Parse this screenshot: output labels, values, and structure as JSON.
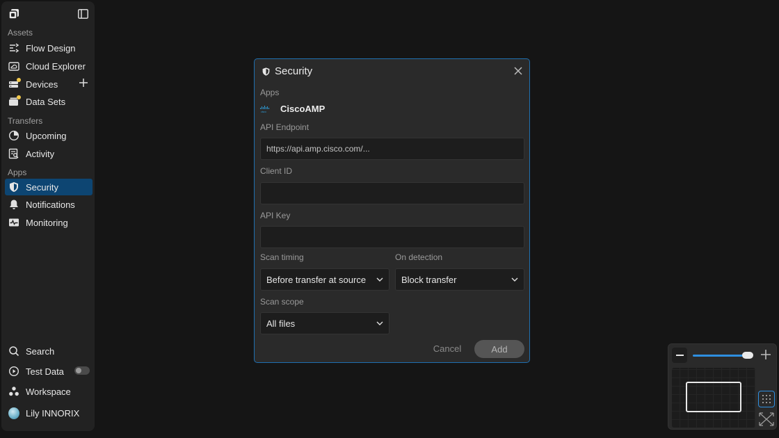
{
  "sidebar": {
    "sections": [
      {
        "label": "Assets"
      },
      {
        "label": "Transfers"
      },
      {
        "label": "Apps"
      }
    ],
    "items": [
      {
        "label": "Flow Design",
        "icon": "flow-icon"
      },
      {
        "label": "Cloud Explorer",
        "icon": "cloud-icon"
      },
      {
        "label": "Devices",
        "icon": "devices-icon"
      },
      {
        "label": "Data Sets",
        "icon": "datasets-icon"
      },
      {
        "label": "Upcoming",
        "icon": "clock-icon"
      },
      {
        "label": "Activity",
        "icon": "activity-icon"
      },
      {
        "label": "Security",
        "icon": "shield-icon",
        "active": true
      },
      {
        "label": "Notifications",
        "icon": "bell-icon"
      },
      {
        "label": "Monitoring",
        "icon": "monitor-icon"
      }
    ],
    "bottom": {
      "search": "Search",
      "test_data": "Test Data",
      "test_data_enabled": false,
      "workspace": "Workspace",
      "user": "Lily INNORIX"
    }
  },
  "modal": {
    "title": "Security",
    "apps_label": "Apps",
    "app_name": "CiscoAMP",
    "api_endpoint_label": "API Endpoint",
    "api_endpoint_placeholder": "https://api.amp.cisco.com/...",
    "client_id_label": "Client ID",
    "client_id_value": "",
    "api_key_label": "API Key",
    "api_key_value": "",
    "scan_timing_label": "Scan timing",
    "scan_timing_value": "Before transfer at source",
    "on_detection_label": "On detection",
    "on_detection_value": "Block transfer",
    "scan_scope_label": "Scan scope",
    "scan_scope_value": "All files",
    "cancel_label": "Cancel",
    "add_label": "Add"
  },
  "minimap": {
    "zoom_level": 0.92
  },
  "colors": {
    "accent": "#2e8fe0",
    "active_nav": "#0d4572",
    "badge": "#f2c94c"
  }
}
